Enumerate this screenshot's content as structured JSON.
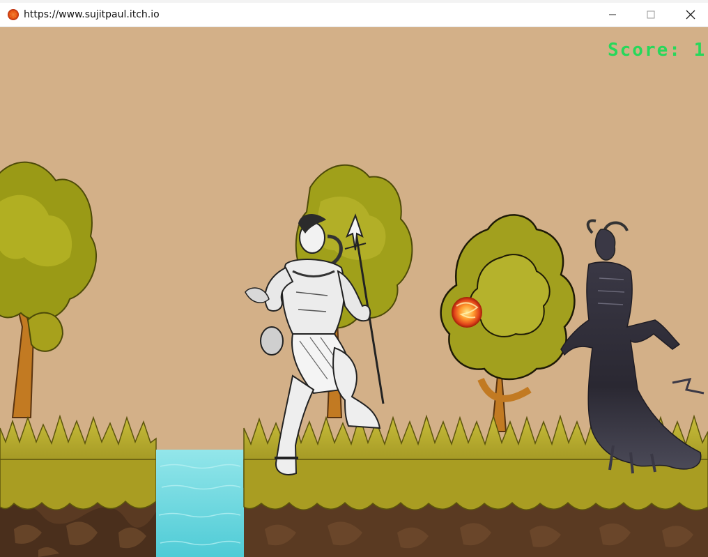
{
  "window": {
    "url": "https://www.sujitpaul.itch.io",
    "favicon": "fireball-icon",
    "controls": [
      "minimize-icon",
      "maximize-icon",
      "close-icon"
    ]
  },
  "game": {
    "score_label": "Score: 1",
    "colors": {
      "sky": "#d3b088",
      "score": "#27d85a",
      "grass": "#b3a72a",
      "soil": "#5a3a22",
      "water": "#7fdfe6"
    },
    "characters": [
      "shiva-warrior-player",
      "horned-wraith-enemy"
    ],
    "projectile": "fireball"
  }
}
